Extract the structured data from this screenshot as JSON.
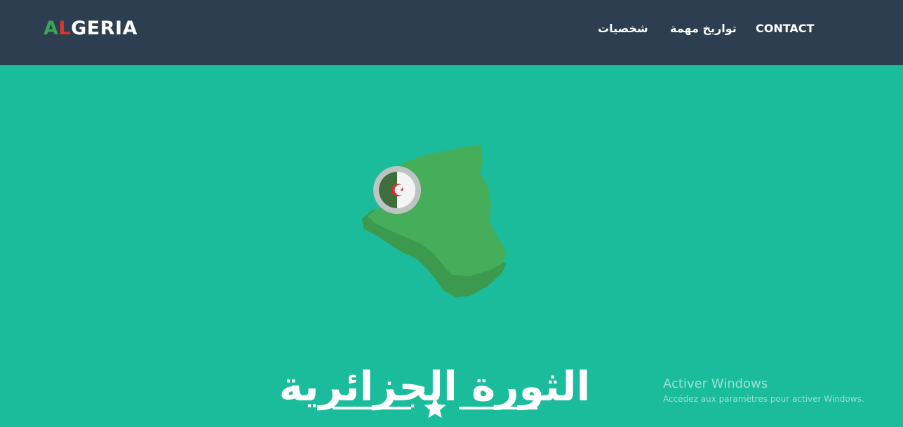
{
  "brand": {
    "part_a": "A",
    "part_l": "L",
    "part_rest": "GERIA"
  },
  "nav": {
    "items": [
      {
        "label": "شخصيات"
      },
      {
        "label": "تواريخ مهمة"
      },
      {
        "label": "CONTACT"
      }
    ]
  },
  "hero": {
    "title": "الثورة الجزائرية",
    "map_icon": "algeria-map-icon",
    "flag_icon": "algeria-flag-icon",
    "divider_icon": "star-icon"
  },
  "watermark": {
    "title": "Activer Windows",
    "subtitle": "Accédez aux paramètres pour activer Windows."
  },
  "colors": {
    "navbar": "#2c3e50",
    "hero_bg": "#1abc9c",
    "brand_green": "#3aa655",
    "brand_red": "#e0322f",
    "map_green": "#46ae5a",
    "map_shadow": "#3c9a4e"
  }
}
